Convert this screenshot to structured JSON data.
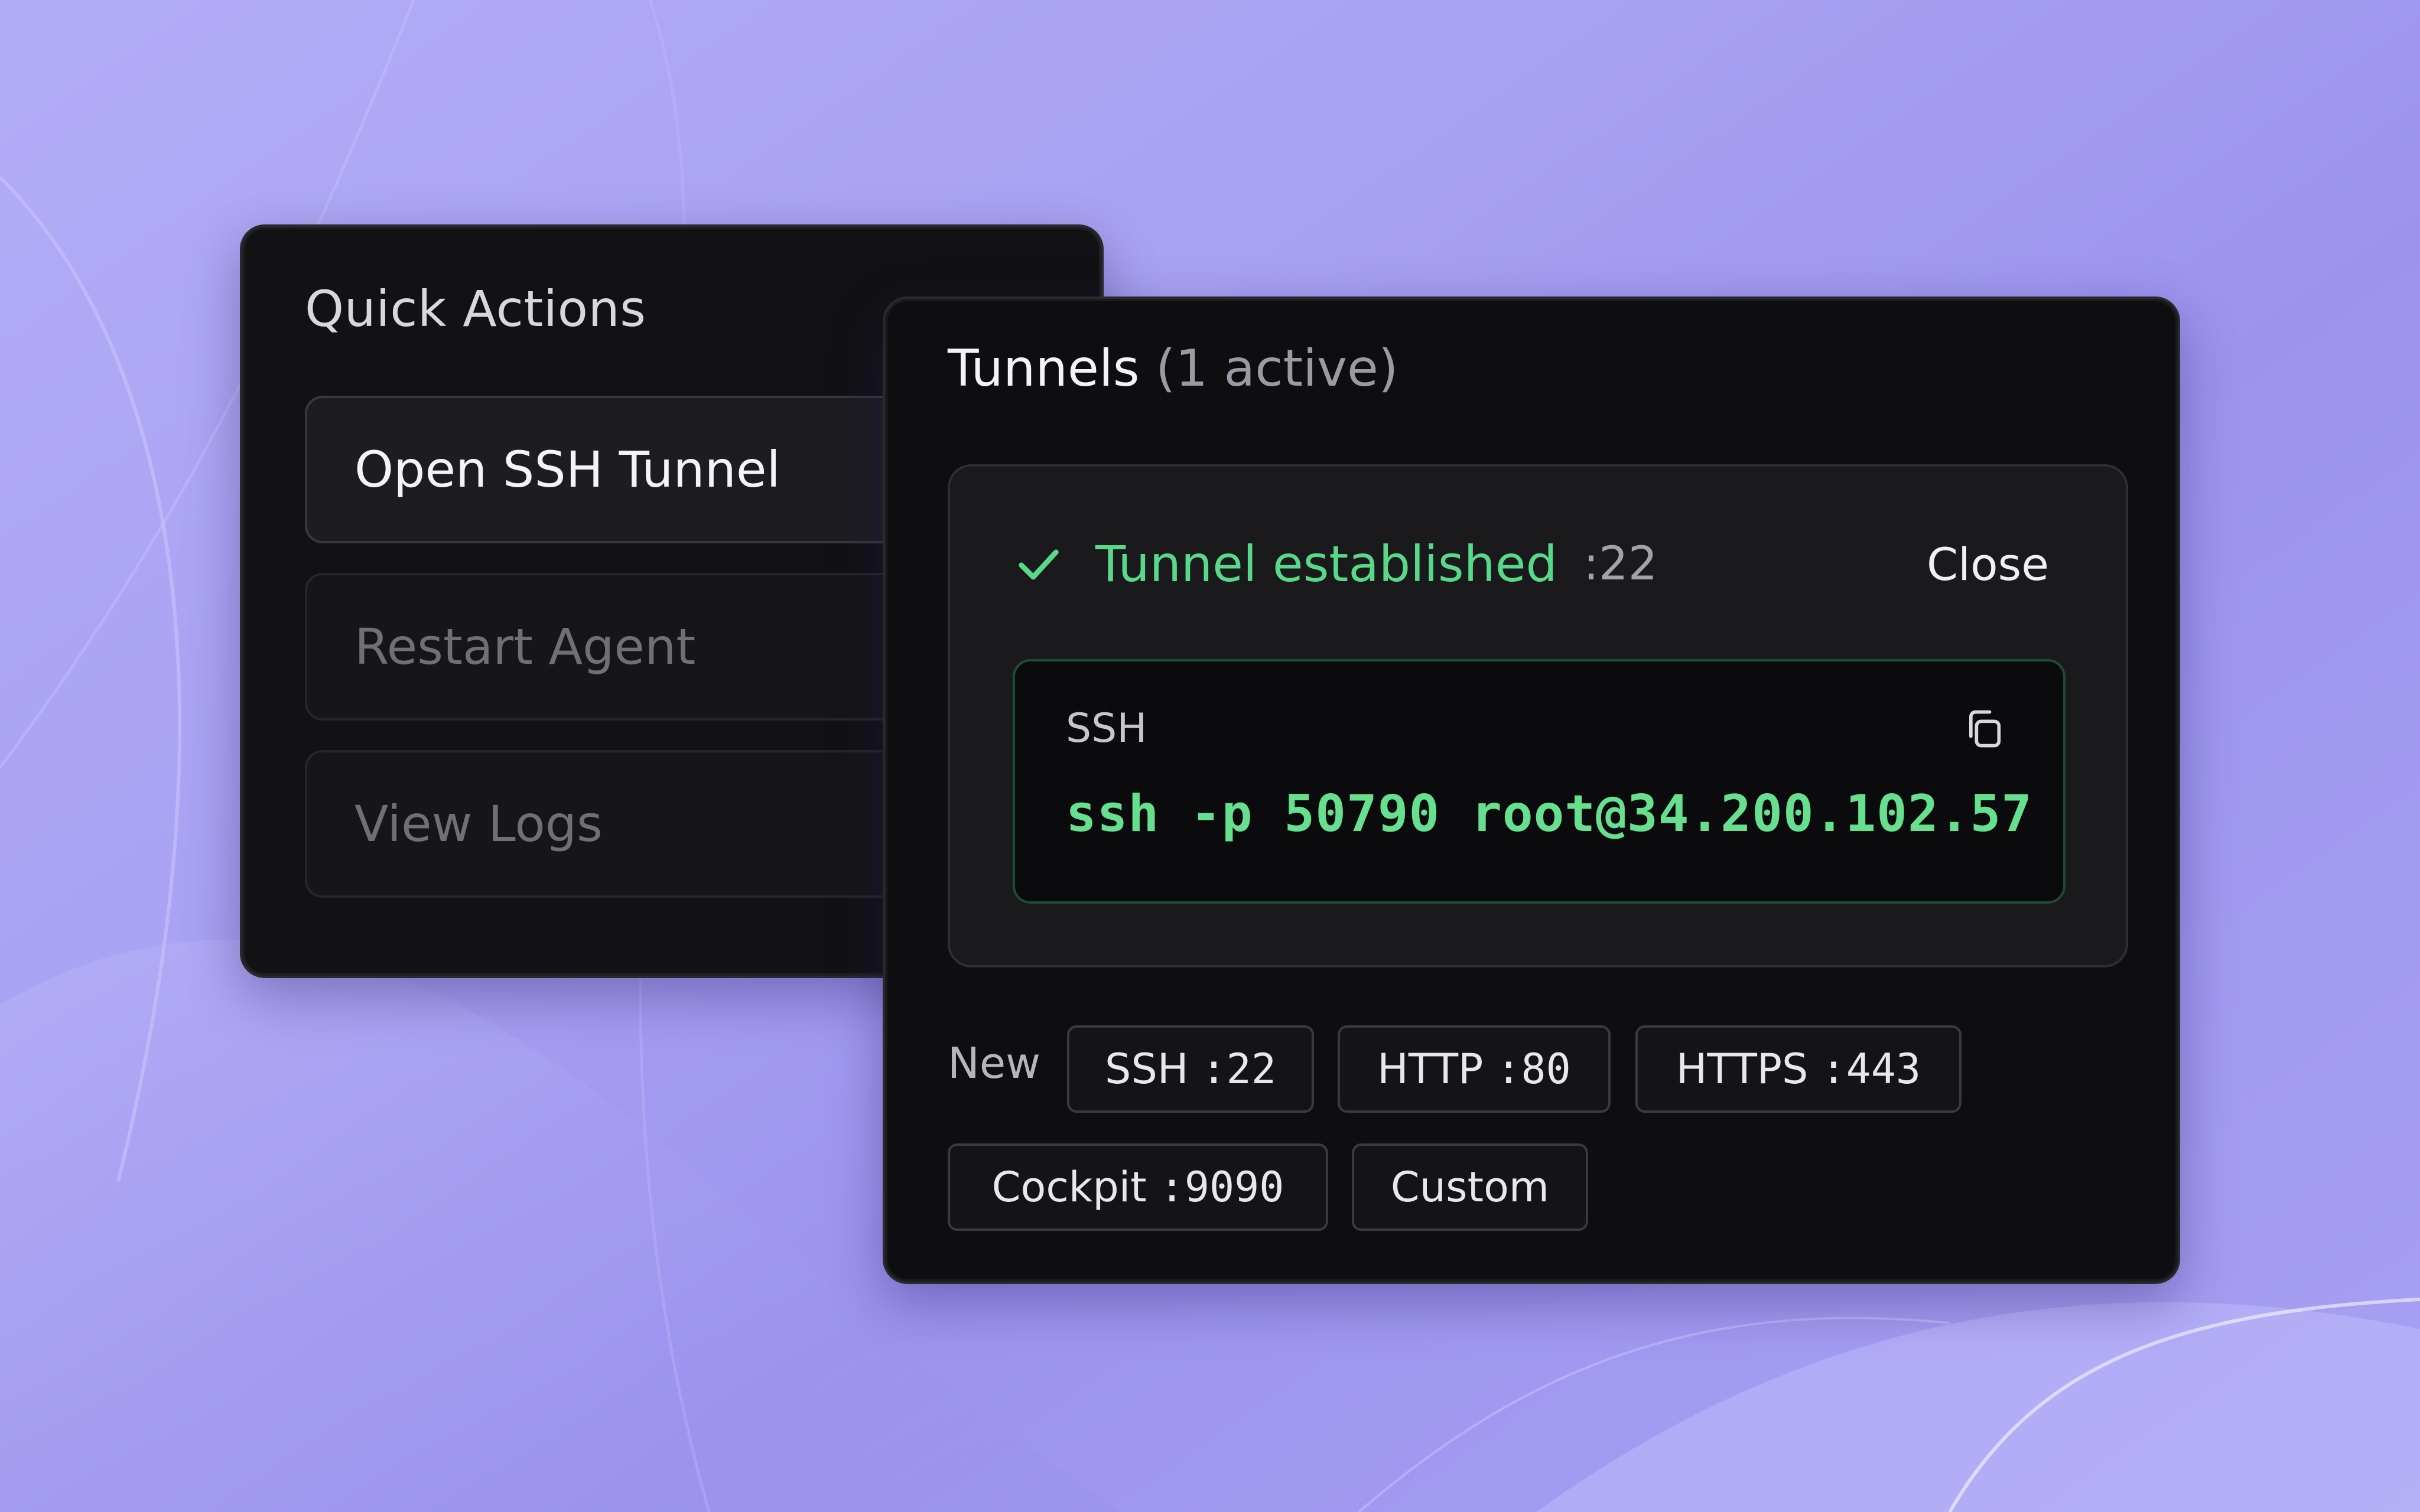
{
  "colors": {
    "background": "#a9a1f2",
    "panel": "#121214",
    "success": "#57d989",
    "command": "#66e08f"
  },
  "quick_actions": {
    "title": "Quick Actions",
    "buttons": [
      {
        "label": "Open SSH Tunnel",
        "state": "enabled"
      },
      {
        "label": "Restart Agent",
        "state": "disabled"
      },
      {
        "label": "View Logs",
        "state": "disabled"
      }
    ]
  },
  "tunnels": {
    "title": "Tunnels",
    "count_text": "(1 active)",
    "status": {
      "icon": "check-icon",
      "text": "Tunnel established",
      "port": ":22",
      "close_label": "Close"
    },
    "command": {
      "label": "SSH",
      "text": "ssh -p 50790 root@34.200.102.57",
      "copy_icon": "copy-icon"
    },
    "new_label": "New",
    "presets": [
      {
        "name": "SSH",
        "port": ":22"
      },
      {
        "name": "HTTP",
        "port": ":80"
      },
      {
        "name": "HTTPS",
        "port": ":443"
      },
      {
        "name": "Cockpit",
        "port": ":9090"
      },
      {
        "name": "Custom",
        "port": ""
      }
    ]
  }
}
